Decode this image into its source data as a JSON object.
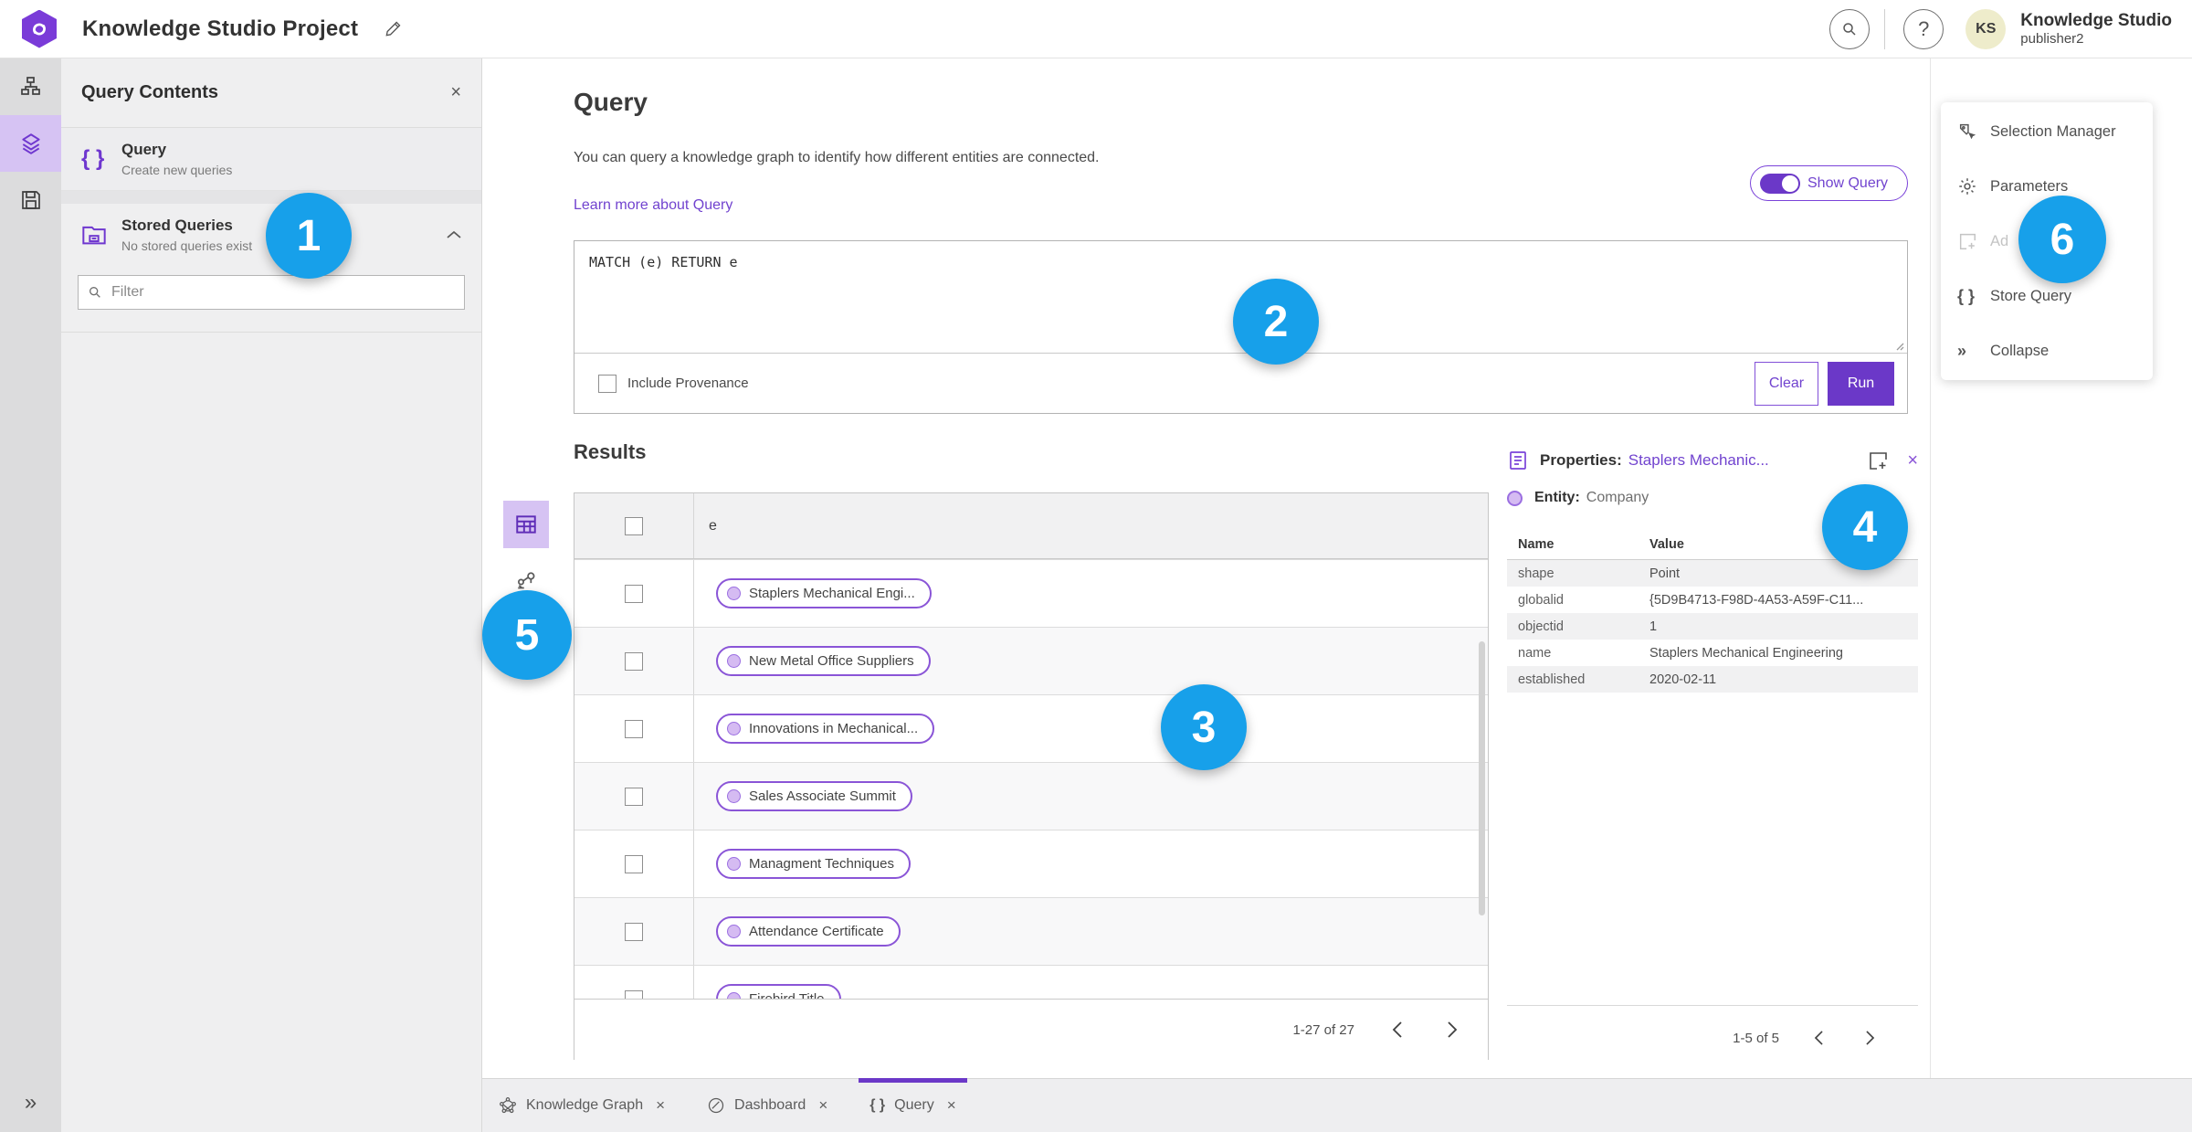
{
  "app": {
    "title": "Knowledge Studio Project",
    "product_name": "Knowledge Studio",
    "user_name": "publisher2",
    "avatar_initials": "KS"
  },
  "colors": {
    "accent_purple": "#6b38c8",
    "link_purple": "#7143cf",
    "badge_blue": "#17a0ea",
    "pill_border": "#8a55d7",
    "pill_dot_fill": "#d5bbf2",
    "rail_selected_bg": "#d6c3f3",
    "avatar_bg": "#eeeccb"
  },
  "icons": {
    "braces": "{ }",
    "close": "×",
    "question": "?",
    "double_chevron": "»"
  },
  "sidebar": {
    "panel_title": "Query Contents",
    "items": [
      {
        "label": "Query",
        "sub": "Create new queries"
      },
      {
        "label": "Stored Queries",
        "sub": "No stored queries exist"
      }
    ],
    "filter_placeholder": "Filter"
  },
  "query": {
    "heading": "Query",
    "description": "You can query a knowledge graph to identify how different entities are connected.",
    "learn_link": "Learn more about Query",
    "show_query_label": "Show Query",
    "query_text": "MATCH (e) RETURN e",
    "include_provenance_label": "Include Provenance",
    "clear_label": "Clear",
    "run_label": "Run"
  },
  "results": {
    "heading": "Results",
    "column": "e",
    "rows": [
      "Staplers Mechanical Engi...",
      "New Metal Office Suppliers",
      "Innovations in Mechanical...",
      "Sales Associate Summit",
      "Managment Techniques",
      "Attendance Certificate",
      "Firebird Title"
    ],
    "pagination": "1-27 of 27"
  },
  "properties": {
    "title_label": "Properties:",
    "title_link": "Staplers Mechanic...",
    "entity_label": "Entity:",
    "entity_value": "Company",
    "columns": [
      "Name",
      "Value"
    ],
    "rows": [
      {
        "name": "shape",
        "value": "Point"
      },
      {
        "name": "globalid",
        "value": "{5D9B4713-F98D-4A53-A59F-C11..."
      },
      {
        "name": "objectid",
        "value": "1"
      },
      {
        "name": "name",
        "value": "Staplers Mechanical Engineering"
      },
      {
        "name": "established",
        "value": "2020-02-11"
      }
    ],
    "pagination": "1-5 of 5"
  },
  "menu": {
    "items": [
      {
        "label": "Selection Manager"
      },
      {
        "label": "Parameters"
      },
      {
        "label": "Ad"
      },
      {
        "label": "Store Query"
      },
      {
        "label": "Collapse"
      }
    ]
  },
  "tabs": [
    {
      "label": "Knowledge Graph"
    },
    {
      "label": "Dashboard"
    },
    {
      "label": "Query"
    }
  ],
  "badges": [
    "1",
    "2",
    "3",
    "4",
    "5",
    "6"
  ]
}
